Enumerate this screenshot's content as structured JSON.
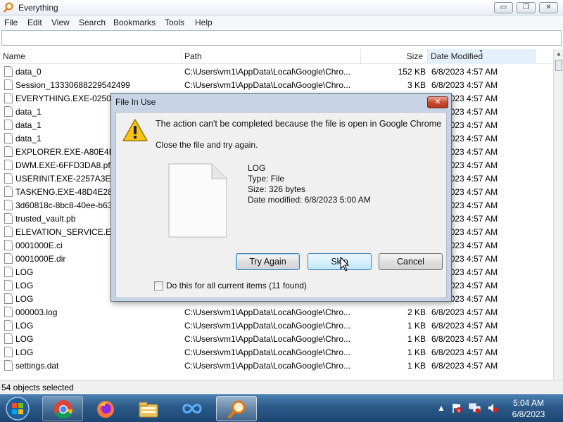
{
  "window": {
    "title": "Everything",
    "controls": {
      "minimize": "▭",
      "maximize": "❐",
      "close": "✕"
    }
  },
  "menu": [
    "File",
    "Edit",
    "View",
    "Search",
    "Bookmarks",
    "Tools",
    "Help"
  ],
  "search": {
    "value": ""
  },
  "columns": {
    "name": "Name",
    "path": "Path",
    "size": "Size",
    "date": "Date Modified"
  },
  "files": [
    {
      "name": "data_0",
      "path": "C:\\Users\\vm1\\AppData\\Local\\Google\\Chro...",
      "size": "152 KB",
      "date": "6/8/2023 4:57 AM"
    },
    {
      "name": "Session_13330688229542499",
      "path": "C:\\Users\\vm1\\AppData\\Local\\Google\\Chro...",
      "size": "3 KB",
      "date": "6/8/2023 4:57 AM"
    },
    {
      "name": "EVERYTHING.EXE-0250190",
      "path": "",
      "size": "",
      "date": "6/8/2023 4:57 AM"
    },
    {
      "name": "data_1",
      "path": "",
      "size": "",
      "date": "6/8/2023 4:57 AM"
    },
    {
      "name": "data_1",
      "path": "",
      "size": "",
      "date": "6/8/2023 4:57 AM"
    },
    {
      "name": "data_1",
      "path": "",
      "size": "",
      "date": "6/8/2023 4:57 AM"
    },
    {
      "name": "EXPLORER.EXE-A80E4F97.",
      "path": "",
      "size": "",
      "date": "6/8/2023 4:57 AM"
    },
    {
      "name": "DWM.EXE-6FFD3DA8.pf",
      "path": "",
      "size": "",
      "date": "6/8/2023 4:57 AM"
    },
    {
      "name": "USERINIT.EXE-2257A3E7.p",
      "path": "",
      "size": "",
      "date": "6/8/2023 4:57 AM"
    },
    {
      "name": "TASKENG.EXE-48D4E289.p",
      "path": "",
      "size": "",
      "date": "6/8/2023 4:57 AM"
    },
    {
      "name": "3d60818c-8bc8-40ee-b636",
      "path": "",
      "size": "",
      "date": "6/8/2023 4:57 AM"
    },
    {
      "name": "trusted_vault.pb",
      "path": "",
      "size": "",
      "date": "6/8/2023 4:57 AM"
    },
    {
      "name": "ELEVATION_SERVICE.EXE-",
      "path": "",
      "size": "",
      "date": "6/8/2023 4:57 AM"
    },
    {
      "name": "0001000E.ci",
      "path": "",
      "size": "",
      "date": "6/8/2023 4:57 AM"
    },
    {
      "name": "0001000E.dir",
      "path": "",
      "size": "",
      "date": "6/8/2023 4:57 AM"
    },
    {
      "name": "LOG",
      "path": "",
      "size": "",
      "date": "6/8/2023 4:57 AM"
    },
    {
      "name": "LOG",
      "path": "",
      "size": "",
      "date": "6/8/2023 4:57 AM"
    },
    {
      "name": "LOG",
      "path": "",
      "size": "",
      "date": "6/8/2023 4:57 AM"
    },
    {
      "name": "000003.log",
      "path": "C:\\Users\\vm1\\AppData\\Local\\Google\\Chro...",
      "size": "2 KB",
      "date": "6/8/2023 4:57 AM"
    },
    {
      "name": "LOG",
      "path": "C:\\Users\\vm1\\AppData\\Local\\Google\\Chro...",
      "size": "1 KB",
      "date": "6/8/2023 4:57 AM"
    },
    {
      "name": "LOG",
      "path": "C:\\Users\\vm1\\AppData\\Local\\Google\\Chro...",
      "size": "1 KB",
      "date": "6/8/2023 4:57 AM"
    },
    {
      "name": "LOG",
      "path": "C:\\Users\\vm1\\AppData\\Local\\Google\\Chro...",
      "size": "1 KB",
      "date": "6/8/2023 4:57 AM"
    },
    {
      "name": "settings.dat",
      "path": "C:\\Users\\vm1\\AppData\\Local\\Google\\Chro...",
      "size": "1 KB",
      "date": "6/8/2023 4:57 AM"
    }
  ],
  "status": {
    "text": "54 objects selected"
  },
  "dialog": {
    "title": "File In Use",
    "close": "✕",
    "message": "The action can't be completed because the file is open in Google Chrome",
    "instruction": "Close the file and try again.",
    "file": {
      "name": "LOG",
      "type": "Type: File",
      "size": "Size: 326 bytes",
      "modified": "Date modified: 6/8/2023 5:00 AM"
    },
    "buttons": {
      "try_again": "Try Again",
      "skip": "Skip",
      "cancel": "Cancel"
    },
    "checkbox": {
      "label": "Do this for all current items (11 found)",
      "checked": false
    }
  },
  "taskbar": {
    "apps": [
      "start-orb",
      "chrome-icon",
      "firefox-icon",
      "file-explorer-icon",
      "infinity-app-icon",
      "everything-search-icon"
    ],
    "clock": {
      "time": "5:04 AM",
      "date": "6/8/2023"
    }
  }
}
